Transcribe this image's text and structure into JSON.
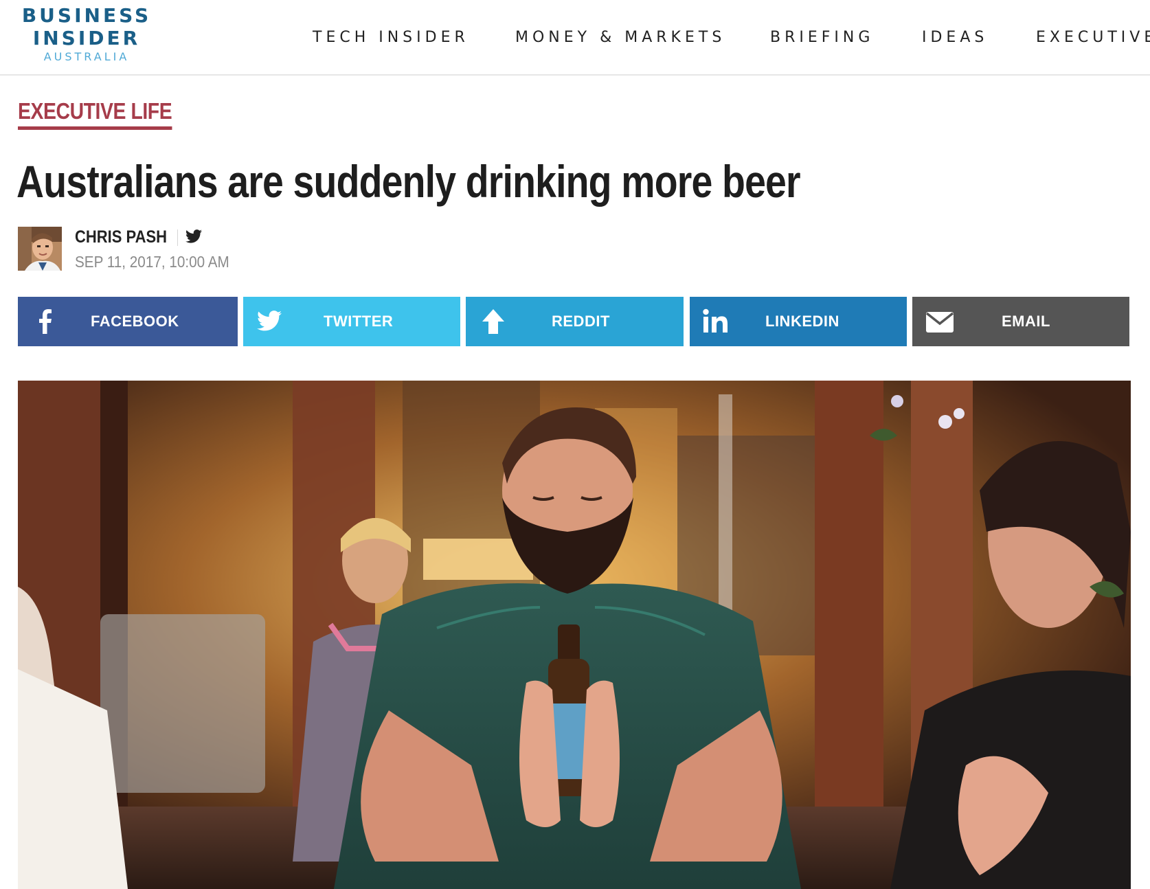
{
  "header": {
    "logo": {
      "line1": "BUSINESS",
      "line2": "INSIDER",
      "line3": "AUSTRALIA"
    },
    "nav": [
      {
        "label": "TECH INSIDER"
      },
      {
        "label": "MONEY & MARKETS"
      },
      {
        "label": "BRIEFING"
      },
      {
        "label": "IDEAS"
      },
      {
        "label": "EXECUTIVE"
      }
    ]
  },
  "article": {
    "section": "EXECUTIVE LIFE",
    "headline": "Australians are suddenly drinking more beer",
    "author": {
      "name": "CHRIS PASH",
      "social": "twitter-icon"
    },
    "date": "SEP 11, 2017, 10:00 AM"
  },
  "share": [
    {
      "label": "FACEBOOK",
      "icon": "facebook-icon",
      "color": "#3b5998"
    },
    {
      "label": "TWITTER",
      "icon": "twitter-icon",
      "color": "#3ec3ec"
    },
    {
      "label": "REDDIT",
      "icon": "arrow-up-icon",
      "color": "#2aa4d5"
    },
    {
      "label": "LINKEDIN",
      "icon": "linkedin-icon",
      "color": "#1f7bb6"
    },
    {
      "label": "EMAIL",
      "icon": "envelope-icon",
      "color": "#555555"
    }
  ],
  "colors": {
    "logo_dark": "#1a5f88",
    "logo_light": "#4fa9d6",
    "section_accent": "#a63c4a"
  }
}
